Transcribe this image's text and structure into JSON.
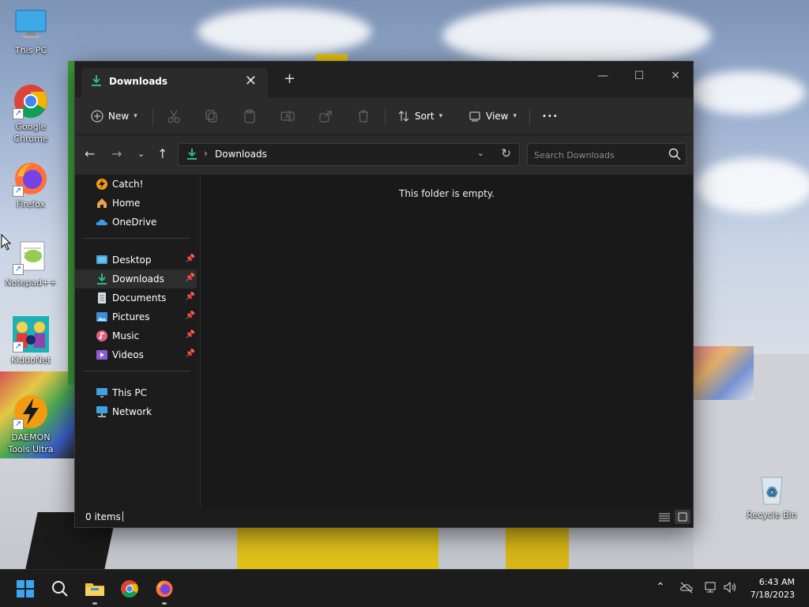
{
  "desktop": {
    "icons": [
      {
        "label": "This PC"
      },
      {
        "label": "Google Chrome"
      },
      {
        "label": "Firefox"
      },
      {
        "label": "Notepad++"
      },
      {
        "label": "KiddoNet"
      },
      {
        "label": "DAEMON Tools Ultra"
      },
      {
        "label": "Recycle Bin"
      }
    ]
  },
  "explorer": {
    "tab": {
      "title": "Downloads",
      "close_glyph": "✕"
    },
    "new_tab_glyph": "+",
    "window_controls": {
      "minimize": "—",
      "maximize": "☐",
      "close": "✕"
    },
    "toolbar": {
      "new_label": "New",
      "sort_label": "Sort",
      "view_label": "View",
      "more_glyph": "•••"
    },
    "address": {
      "path": "Downloads",
      "search_placeholder": "Search Downloads"
    },
    "sidebar": {
      "quick": [
        {
          "label": "Catch!"
        },
        {
          "label": "Home"
        },
        {
          "label": "OneDrive"
        }
      ],
      "pinned": [
        {
          "label": "Desktop"
        },
        {
          "label": "Downloads"
        },
        {
          "label": "Documents"
        },
        {
          "label": "Pictures"
        },
        {
          "label": "Music"
        },
        {
          "label": "Videos"
        }
      ],
      "locations": [
        {
          "label": "This PC"
        },
        {
          "label": "Network"
        }
      ]
    },
    "content": {
      "empty_message": "This folder is empty."
    },
    "status": {
      "items": "0 items"
    }
  },
  "taskbar": {
    "time": "6:43 AM",
    "date": "7/18/2023"
  },
  "colors": {
    "accent_green": "#2fb98a",
    "window_bg": "#1c1c1c",
    "toolbar_bg": "#2b2b2b"
  }
}
